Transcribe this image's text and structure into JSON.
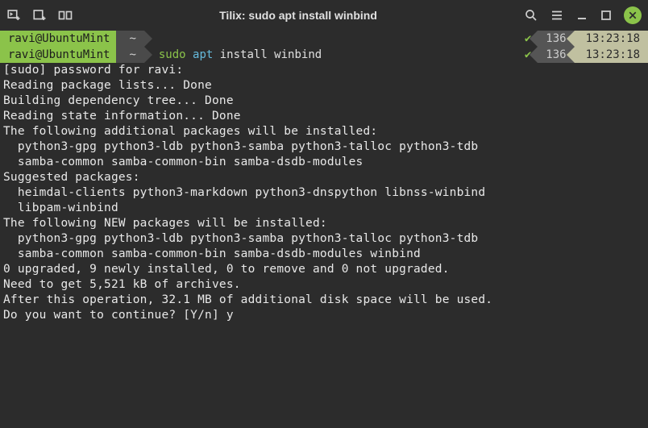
{
  "window": {
    "title": "Tilix: sudo apt install winbind"
  },
  "prompts": [
    {
      "user": "ravi@UbuntuMint",
      "path": "~",
      "sudo": "",
      "cmd": "",
      "args": "",
      "check": "✔",
      "num": "136",
      "time": "13:23:18"
    },
    {
      "user": "ravi@UbuntuMint",
      "path": "~",
      "sudo": "sudo",
      "cmd": " apt",
      "args": " install winbind",
      "check": "✔",
      "num": "136",
      "time": "13:23:18"
    }
  ],
  "output": "[sudo] password for ravi:\nReading package lists... Done\nBuilding dependency tree... Done\nReading state information... Done\nThe following additional packages will be installed:\n  python3-gpg python3-ldb python3-samba python3-talloc python3-tdb\n  samba-common samba-common-bin samba-dsdb-modules\nSuggested packages:\n  heimdal-clients python3-markdown python3-dnspython libnss-winbind\n  libpam-winbind\nThe following NEW packages will be installed:\n  python3-gpg python3-ldb python3-samba python3-talloc python3-tdb\n  samba-common samba-common-bin samba-dsdb-modules winbind\n0 upgraded, 9 newly installed, 0 to remove and 0 not upgraded.\nNeed to get 5,521 kB of archives.\nAfter this operation, 32.1 MB of additional disk space will be used.\nDo you want to continue? [Y/n] y"
}
